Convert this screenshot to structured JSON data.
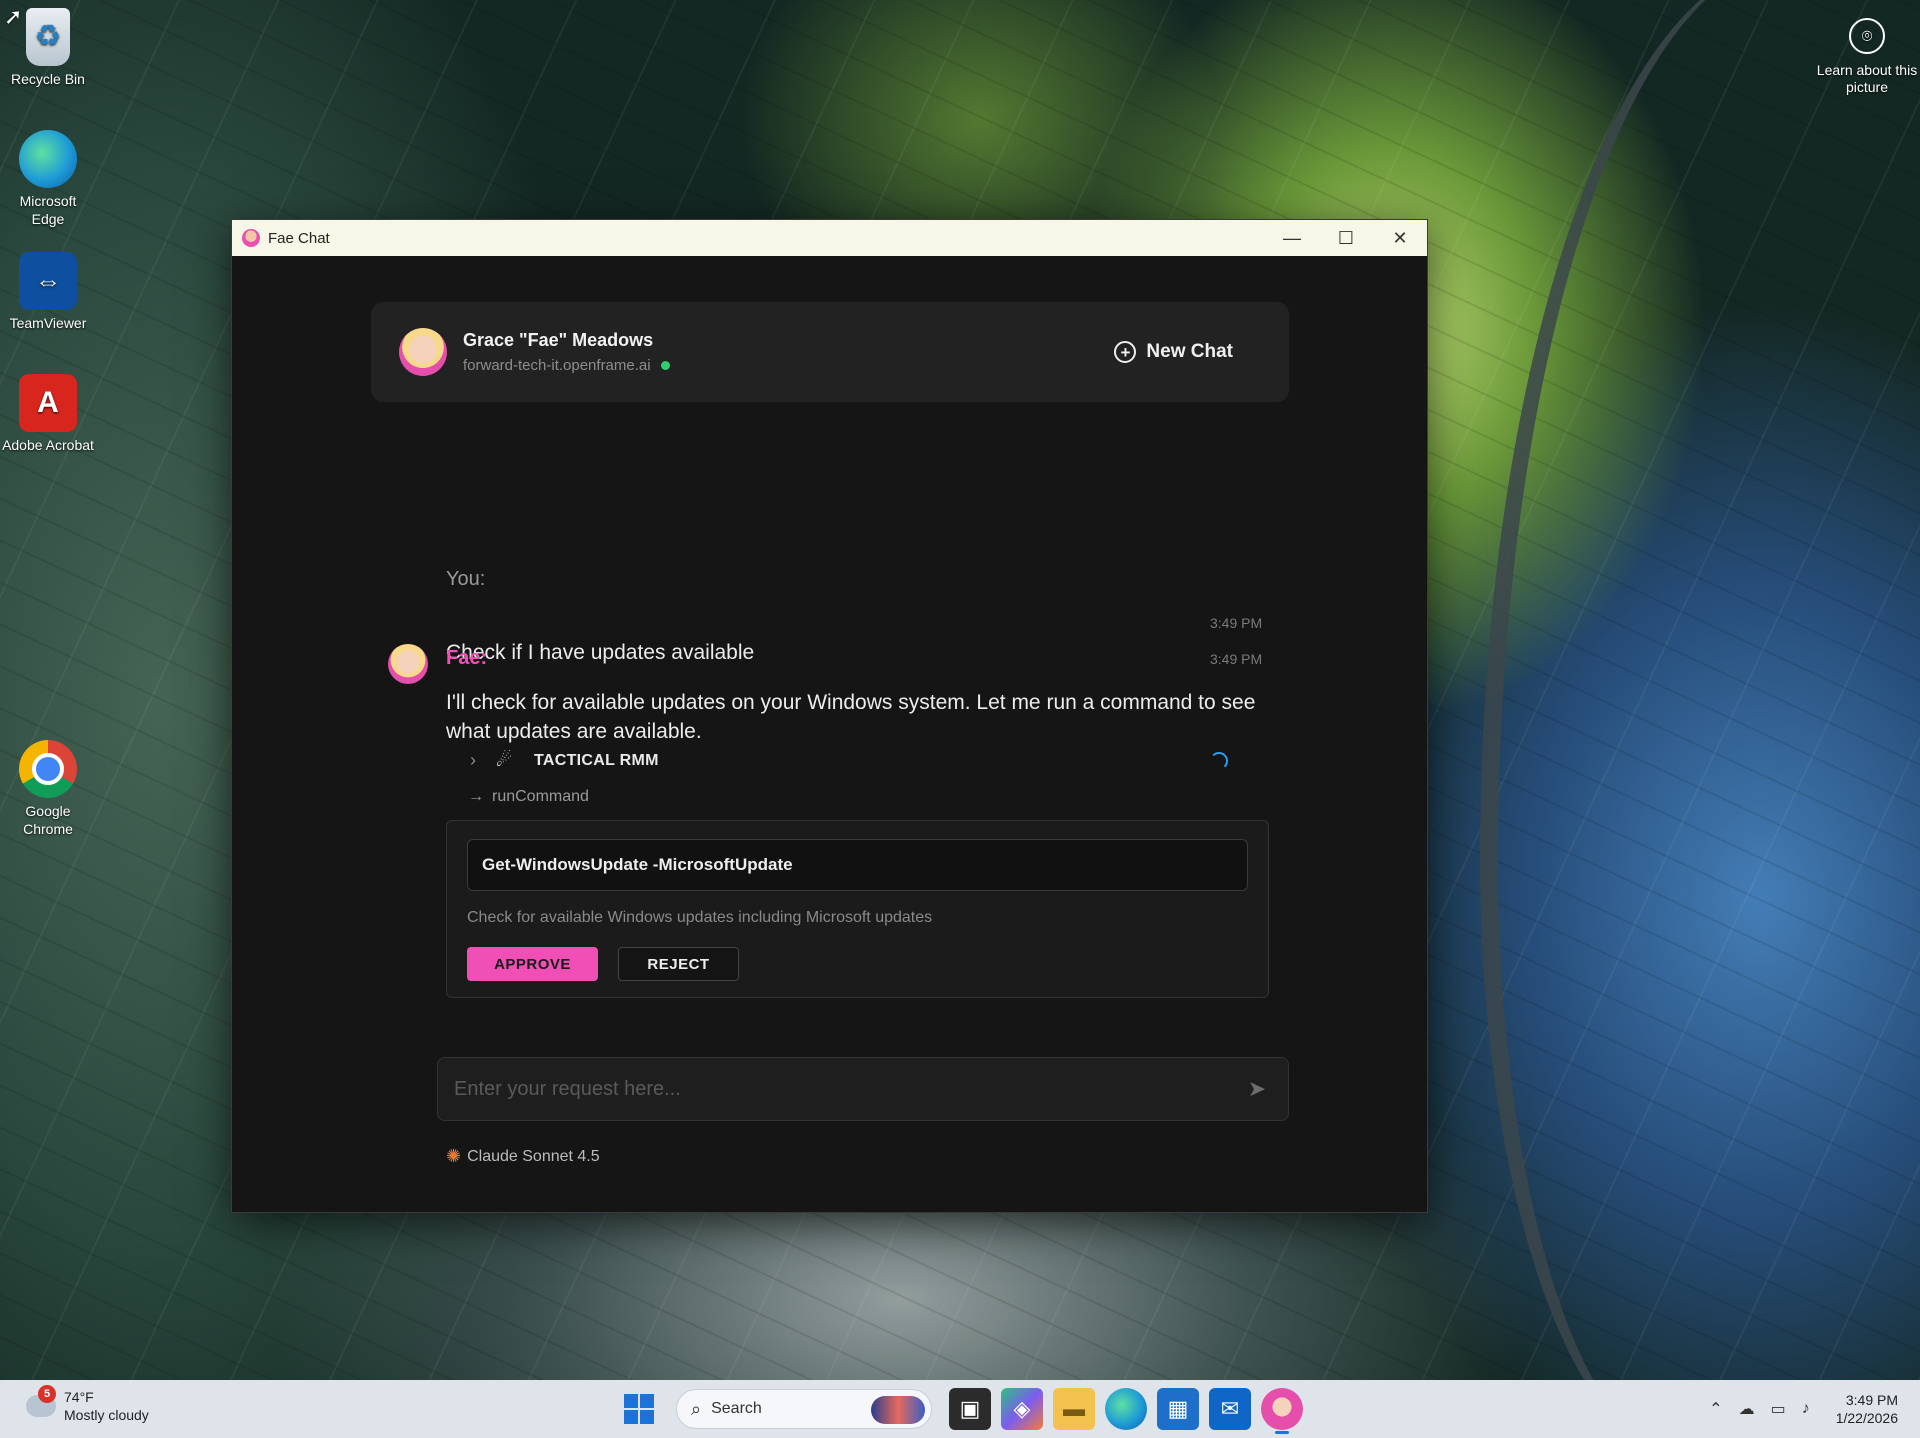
{
  "desktop": {
    "icons": [
      {
        "label": "Recycle Bin",
        "icon": "recycle-bin-icon"
      },
      {
        "label": "Microsoft Edge",
        "icon": "edge-icon"
      },
      {
        "label": "TeamViewer",
        "icon": "teamviewer-icon"
      },
      {
        "label": "Adobe Acrobat",
        "icon": "acrobat-icon"
      },
      {
        "label": "Google Chrome",
        "icon": "chrome-icon"
      }
    ],
    "learn_picture": "Learn about this picture"
  },
  "window": {
    "title": "Fae Chat",
    "controls": {
      "minimize": "—",
      "maximize": "☐",
      "close": "✕"
    }
  },
  "header": {
    "agent_name": "Grace \"Fae\" Meadows",
    "domain": "forward-tech-it.openframe.ai",
    "status_color": "#2ed06e",
    "new_chat_label": "New Chat"
  },
  "conversation": {
    "user_message": {
      "sender": "You:",
      "time": "3:49 PM",
      "text": "Check if I have updates available"
    },
    "assistant_message": {
      "sender": "Fae:",
      "time": "3:49 PM",
      "text": "I'll check for available updates on your Windows system. Let me run a command to see what updates are available."
    },
    "tool_call": {
      "tool_name": "TACTICAL RMM",
      "method": "runCommand",
      "command": "Get-WindowsUpdate -MicrosoftUpdate",
      "description": "Check for available Windows updates including Microsoft updates",
      "approve_label": "APPROVE",
      "reject_label": "REJECT"
    }
  },
  "composer": {
    "placeholder": "Enter your request here...",
    "value": ""
  },
  "model": {
    "name": "Claude Sonnet 4.5"
  },
  "theme": {
    "accent": "#f04fb5",
    "background": "#151515"
  },
  "taskbar": {
    "weather_temp": "74°F",
    "weather_desc": "Mostly cloudy",
    "weather_badge": "5",
    "search_label": "Search",
    "time": "3:49 PM",
    "date": "1/22/2026"
  }
}
